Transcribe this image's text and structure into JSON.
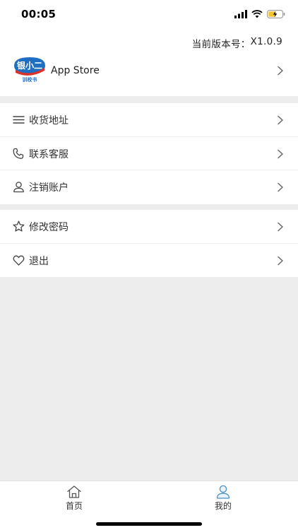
{
  "status": {
    "time": "00:05"
  },
  "header": {
    "version_label": "当前版本号：",
    "version_value": "X1.0.9",
    "app": {
      "logo_text": "银小二",
      "logo_subtext": "训校书",
      "name": "App Store"
    }
  },
  "menu_group_1": [
    {
      "label": "收货地址",
      "icon": "menu-lines-icon"
    },
    {
      "label": "联系客服",
      "icon": "phone-icon"
    },
    {
      "label": "注销账户",
      "icon": "user-icon"
    }
  ],
  "menu_group_2": [
    {
      "label": "修改密码",
      "icon": "star-icon"
    },
    {
      "label": "退出",
      "icon": "heart-icon"
    }
  ],
  "tabbar": [
    {
      "label": "首页",
      "icon": "home-icon",
      "active": false
    },
    {
      "label": "我的",
      "icon": "user-icon",
      "active": true
    }
  ],
  "colors": {
    "background": "#ededed",
    "active_tab": "#4a90c8",
    "logo_blue": "#1e6fc4",
    "logo_red": "#d9342b"
  }
}
